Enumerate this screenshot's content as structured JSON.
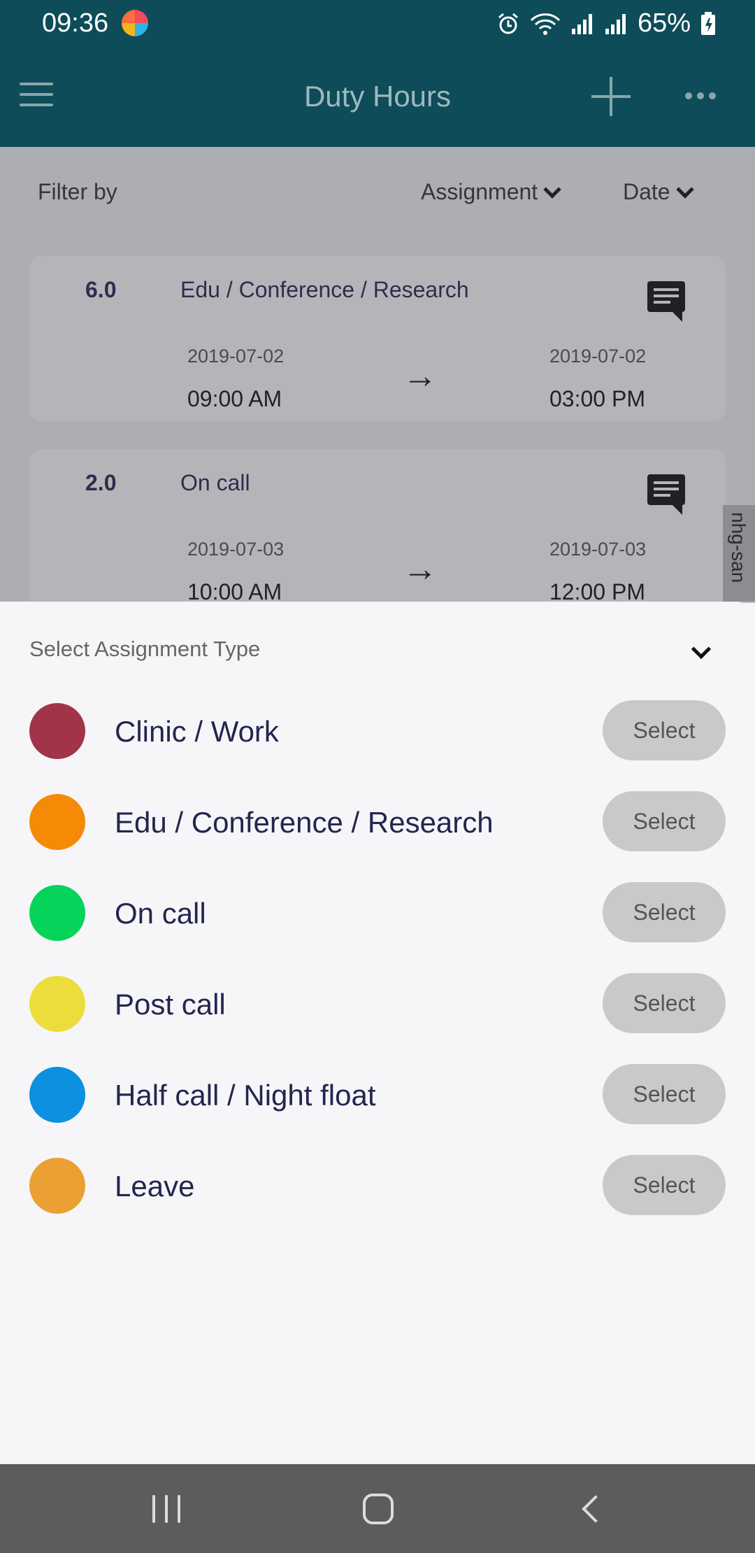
{
  "status_bar": {
    "time": "09:36",
    "battery": "65%"
  },
  "app_bar": {
    "title": "Duty Hours"
  },
  "filter": {
    "label": "Filter by",
    "assignment": "Assignment",
    "date": "Date"
  },
  "entries": [
    {
      "hours": "6.0",
      "type": "Edu / Conference / Research",
      "start_date": "2019-07-02",
      "start_time": "09:00 AM",
      "end_date": "2019-07-02",
      "end_time": "03:00 PM"
    },
    {
      "hours": "2.0",
      "type": "On call",
      "start_date": "2019-07-03",
      "start_time": "10:00 AM",
      "end_date": "2019-07-03",
      "end_time": "12:00 PM"
    }
  ],
  "side_tab": "nhg-san",
  "sheet": {
    "title": "Select Assignment Type",
    "options": [
      {
        "name": "Clinic / Work",
        "color": "#a2344a",
        "button": "Select"
      },
      {
        "name": "Edu / Conference / Research",
        "color": "#f58a07",
        "button": "Select"
      },
      {
        "name": "On call",
        "color": "#05d35a",
        "button": "Select"
      },
      {
        "name": "Post call",
        "color": "#ecdd3c",
        "button": "Select"
      },
      {
        "name": "Half call / Night float",
        "color": "#0c90e0",
        "button": "Select"
      },
      {
        "name": "Leave",
        "color": "#eba033",
        "button": "Select"
      }
    ]
  }
}
